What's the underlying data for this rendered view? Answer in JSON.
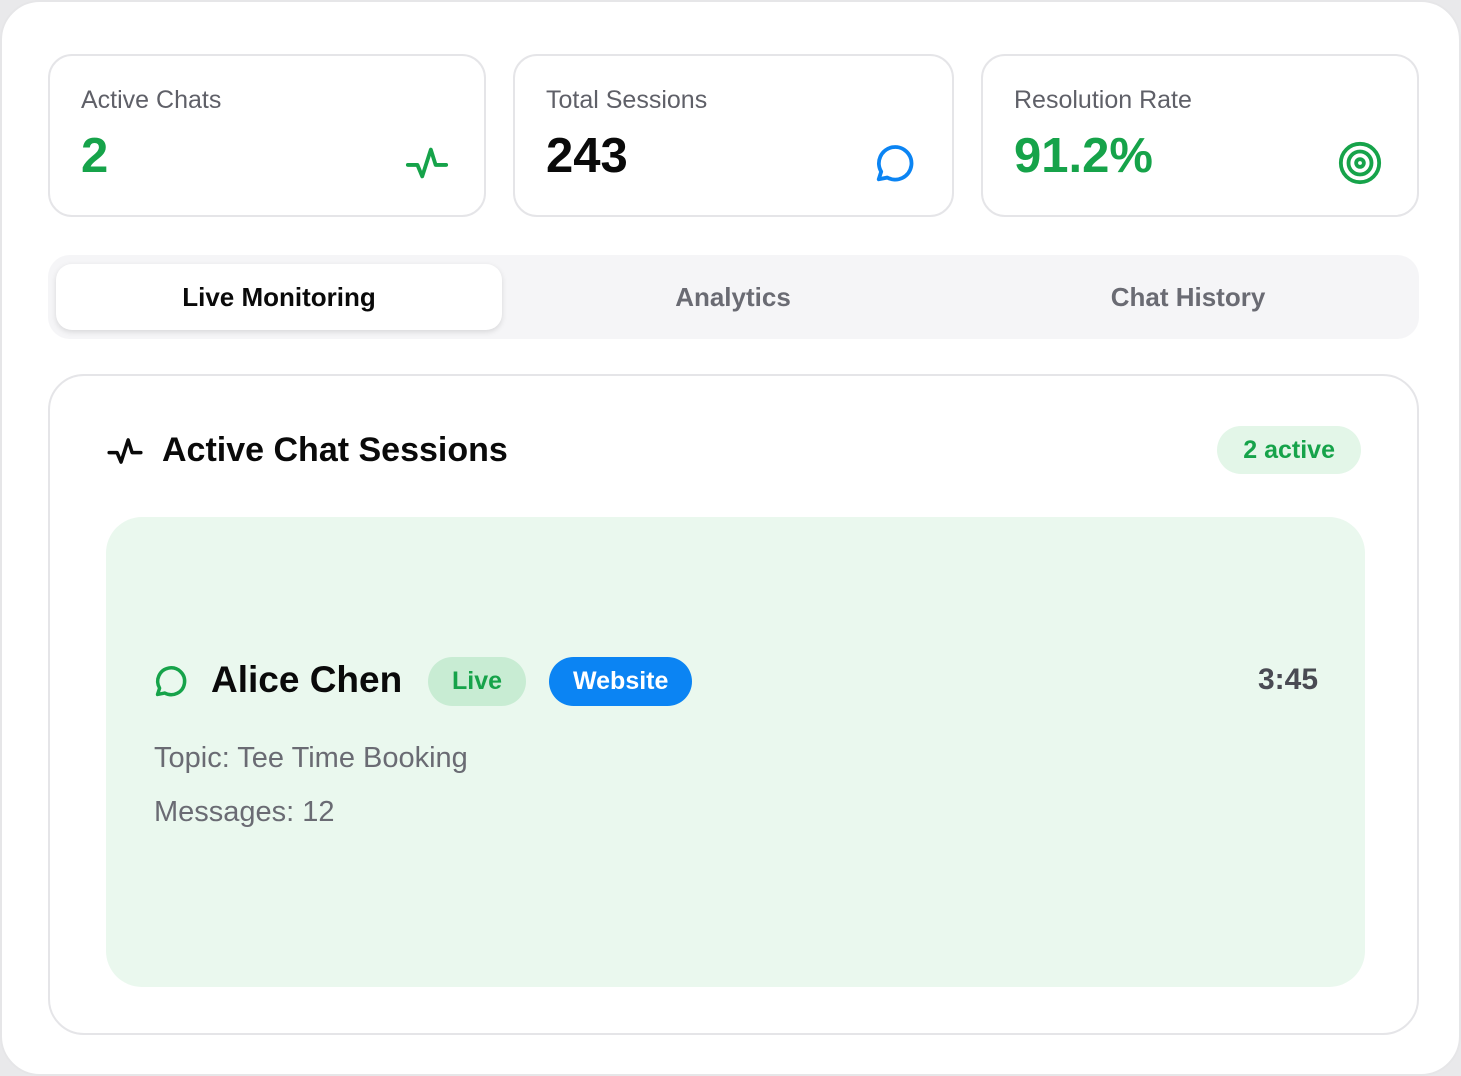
{
  "stats": [
    {
      "label": "Active Chats",
      "value": "2",
      "icon": "activity-icon",
      "color": "#16a34a"
    },
    {
      "label": "Total Sessions",
      "value": "243",
      "icon": "message-circle-icon",
      "color": "#0b84f3"
    },
    {
      "label": "Resolution Rate",
      "value": "91.2%",
      "icon": "target-icon",
      "color": "#16a34a"
    }
  ],
  "tabs": [
    {
      "label": "Live Monitoring",
      "active": true
    },
    {
      "label": "Analytics",
      "active": false
    },
    {
      "label": "Chat History",
      "active": false
    }
  ],
  "panel": {
    "title": "Active Chat Sessions",
    "active_count": "2 active",
    "sessions": [
      {
        "name": "Alice Chen",
        "status": "Live",
        "channel": "Website",
        "duration": "3:45",
        "topic": "Topic: Tee Time Booking",
        "messages": "Messages: 12"
      }
    ]
  }
}
